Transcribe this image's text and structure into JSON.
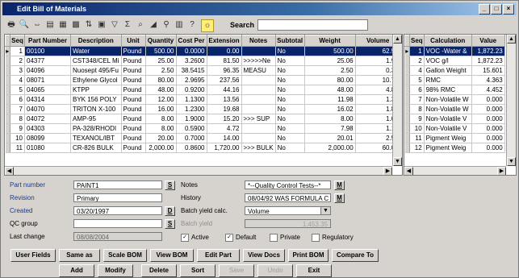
{
  "window": {
    "title": "Edit Bill of Materials",
    "btn_min": "_",
    "btn_max": "□",
    "btn_close": "×"
  },
  "toolbar": {
    "search_label": "Search",
    "search_value": ""
  },
  "bom_grid": {
    "headers": [
      "Seq",
      "Part Number",
      "Description",
      "Unit",
      "Quantity",
      "Cost Per",
      "Extension",
      "Notes",
      "Subtotal",
      "Weight",
      "Volume"
    ],
    "rows": [
      [
        "1",
        "00100",
        "Water",
        "Pound",
        "500.00",
        "0.0000",
        "0.00",
        "",
        "No",
        "500.00",
        "62.50"
      ],
      [
        "2",
        "04377",
        "CST348/CEL Mi",
        "Pound",
        "25.00",
        "3.2600",
        "81.50",
        ">>>>>Ne",
        "No",
        "25.06",
        "1.98"
      ],
      [
        "3",
        "04096",
        "Nuosept 495/Fu",
        "Pound",
        "2.50",
        "38.5415",
        "96.35",
        "MEASU",
        "No",
        "2.50",
        "0.30"
      ],
      [
        "4",
        "08071",
        "Ethylene Glycol",
        "Pound",
        "80.00",
        "2.9695",
        "237.56",
        "",
        "No",
        "80.00",
        "10.72"
      ],
      [
        "5",
        "04065",
        "KTPP",
        "Pound",
        "48.00",
        "0.9200",
        "44.16",
        "",
        "No",
        "48.00",
        "4.80"
      ],
      [
        "6",
        "04314",
        "BYK 156 POLY",
        "Pound",
        "12.00",
        "1.1300",
        "13.56",
        "",
        "No",
        "11.98",
        "1.32"
      ],
      [
        "7",
        "04070",
        "TRITON X-100",
        "Pound",
        "16.00",
        "1.2300",
        "19.68",
        "",
        "No",
        "16.02",
        "1.80"
      ],
      [
        "8",
        "04072",
        "AMP-95",
        "Pound",
        "8.00",
        "1.9000",
        "15.20",
        ">>> SUP",
        "No",
        "8.00",
        "1.01"
      ],
      [
        "9",
        "04303",
        "PA-328/RHODI",
        "Pound",
        "8.00",
        "0.5900",
        "4.72",
        "",
        "No",
        "7.98",
        "1.14"
      ],
      [
        "10",
        "08099",
        "TEXANOL/IBT",
        "Pound",
        "20.00",
        "0.7000",
        "14.00",
        "",
        "No",
        "20.01",
        "2.53"
      ],
      [
        "11",
        "01080",
        "CR-826 BULK",
        "Pound",
        "2,000.00",
        "0.8600",
        "1,720.00",
        ">>> BULK",
        "No",
        "2,000.00",
        "60.00"
      ]
    ]
  },
  "calc_grid": {
    "headers": [
      "Seq",
      "Calculation",
      "Value"
    ],
    "rows": [
      [
        "1",
        "VOC -Water &",
        "1,872.23"
      ],
      [
        "2",
        "VOC g/l",
        "1,872.23"
      ],
      [
        "4",
        "Gallon Weight",
        "15.601"
      ],
      [
        "5",
        "RMC",
        "4.363"
      ],
      [
        "6",
        "98% RMC",
        "4.452"
      ],
      [
        "7",
        "Non-Volatile W",
        "0.000"
      ],
      [
        "8",
        "Non-Volatile W",
        "0.000"
      ],
      [
        "9",
        "Non-Volatile V",
        "0.000"
      ],
      [
        "10",
        "Non-Volatile V",
        "0.000"
      ],
      [
        "11",
        "Pigment Weig",
        "0.000"
      ],
      [
        "12",
        "Pigment Weig",
        "0.000"
      ]
    ]
  },
  "form": {
    "part_number_label": "Part number",
    "part_number": "PAINT1",
    "revision_label": "Revision",
    "revision": "Primary",
    "created_label": "Created",
    "created": "03/20/1997",
    "qc_group_label": "QC group",
    "qc_group": "",
    "last_change_label": "Last change",
    "last_change": "08/08/2004",
    "notes_label": "Notes",
    "notes": "*--Quality Control Tests--*",
    "history_label": "History",
    "history": "08/04/92 WAS FORMULA C",
    "batch_calc_label": "Batch yield calc.",
    "batch_calc": "Volume",
    "batch_yield_label": "Batch yield",
    "batch_yield": "1,453.35",
    "s_btn": "S",
    "d_btn": "D",
    "m_btn": "M",
    "active_label": "Active",
    "default_label": "Default",
    "private_label": "Private",
    "regulatory_label": "Regulatory",
    "active_checked": "✓",
    "default_checked": "✓"
  },
  "buttons_row1": [
    "User Fields",
    "Same as",
    "Scale BOM",
    "View BOM",
    "Edit Part",
    "View Docs",
    "Print BOM",
    "Compare To"
  ],
  "buttons_row2": [
    "Add",
    "Modify",
    "Delete",
    "Sort",
    "Save",
    "Undo",
    "Exit"
  ]
}
